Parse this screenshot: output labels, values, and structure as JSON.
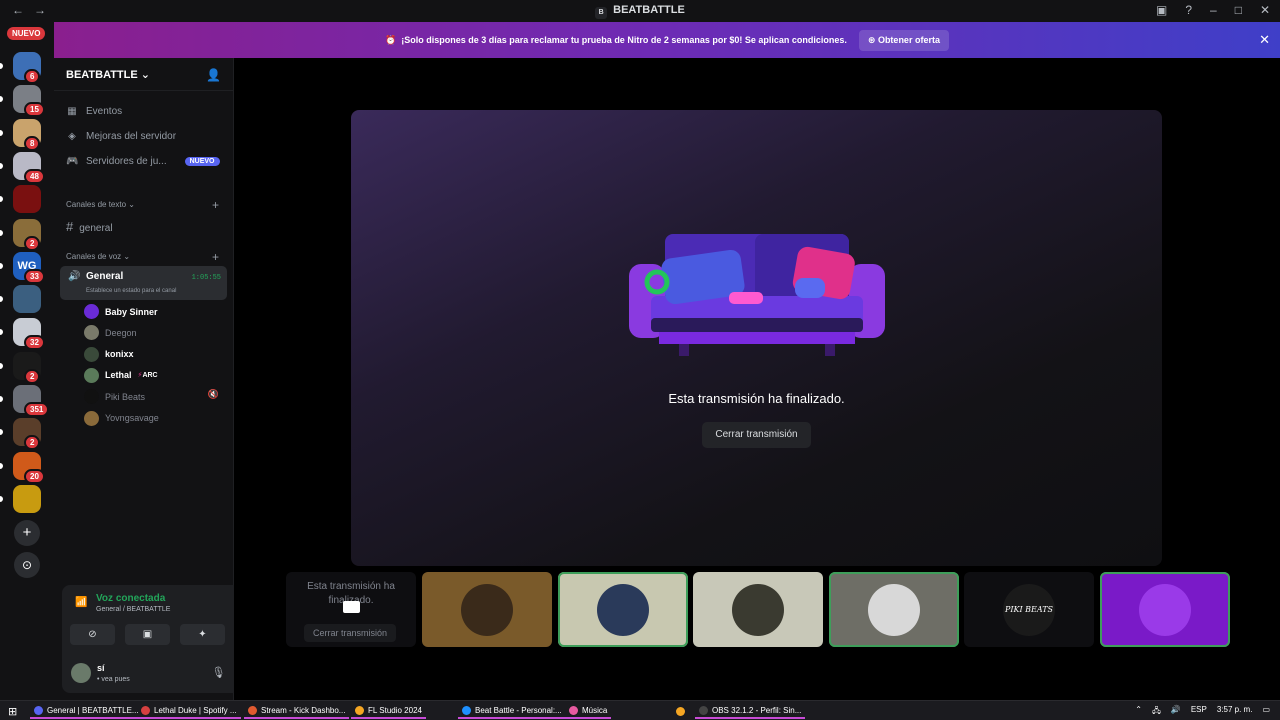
{
  "titlebar": {
    "server_badge": "B",
    "title": "BEATBATTLE"
  },
  "servers": {
    "nuevo_label": "NUEVO",
    "items": [
      {
        "badge": "6",
        "color": "#3d6fb6"
      },
      {
        "badge": "15",
        "color": "#7b7f86"
      },
      {
        "badge": "8",
        "color": "#c9a36c"
      },
      {
        "badge": "48",
        "color": "#b9b9c6"
      },
      {
        "badge": "",
        "color": "#7a1010"
      },
      {
        "badge": "2",
        "color": "#8a6d3a"
      },
      {
        "badge": "33",
        "color": "#1f5fbf",
        "text": "WG"
      },
      {
        "badge": "",
        "color": "#3b5f80"
      },
      {
        "badge": "32",
        "color": "#c8ccd4"
      },
      {
        "badge": "2",
        "color": "#1a1a1a"
      },
      {
        "badge": "351",
        "color": "#6b6f78"
      },
      {
        "badge": "2",
        "color": "#5a3e2a"
      },
      {
        "badge": "20",
        "color": "#d05a1a"
      },
      {
        "badge": "",
        "color": "#c89b10"
      }
    ]
  },
  "banner": {
    "text": "¡Solo dispones de 3 días para reclamar tu prueba de Nitro de 2 semanas por $0! Se aplican condiciones.",
    "button": "Obtener oferta"
  },
  "sidebar": {
    "server_name": "BEATBATTLE",
    "menu": [
      {
        "label": "Eventos"
      },
      {
        "label": "Mejoras del servidor"
      },
      {
        "label": "Servidores de ju...",
        "tag": "NUEVO"
      }
    ],
    "text_category": "Canales de texto",
    "text_channels": [
      {
        "name": "general"
      }
    ],
    "voice_category": "Canales de voz",
    "voice_channel": {
      "name": "General",
      "timer": "1:05:55",
      "status": "Establece un estado para el canal"
    },
    "voice_users": [
      {
        "name": "Baby Sinner",
        "color": "#6a2bd6",
        "active": true
      },
      {
        "name": "Deegon",
        "color": "#7a7a6a",
        "active": false
      },
      {
        "name": "konixx",
        "color": "#3a4a3a",
        "active": true
      },
      {
        "name": "Lethal",
        "tag": "ARC",
        "color": "#5a7a5a",
        "active": true
      },
      {
        "name": "Piki Beats",
        "color": "#111111",
        "active": false,
        "muted": true
      },
      {
        "name": "Yovngsavage",
        "color": "#8a6a3a",
        "active": false
      }
    ]
  },
  "userpanel": {
    "voice_title": "Voz conectada",
    "voice_sub": "General / BEATBATTLE",
    "username": "sí",
    "status": "• vea pues"
  },
  "stream": {
    "ended_text": "Esta transmisión ha finalizado.",
    "close_button": "Cerrar transmisión"
  },
  "tiles": {
    "first_text": "Esta transmisión ha finalizado.",
    "first_button": "Cerrar transmisión",
    "others": [
      {
        "bg": "#7a5a2a",
        "circ": "#3a2a1a",
        "ring": false
      },
      {
        "bg": "#c8c8b0",
        "circ": "#2a3a5a",
        "ring": true
      },
      {
        "bg": "#c8c8b8",
        "circ": "#3a3a30",
        "ring": false
      },
      {
        "bg": "#6e6e66",
        "circ": "#d8d8d8",
        "ring": true
      },
      {
        "bg": "#0e0e11",
        "circ": "#1a1a1a",
        "ring": false,
        "text": "PIKI BEATS"
      },
      {
        "bg": "#7a1ac8",
        "circ": "#9a3ae8",
        "ring": true
      }
    ]
  },
  "taskbar": {
    "items": [
      {
        "label": "General | BEATBATTLE...",
        "color": "#5865f2"
      },
      {
        "label": "Lethal Duke | Spotify ...",
        "color": "#d64040"
      },
      {
        "label": "Stream - Kick Dashbo...",
        "color": "#e05a30"
      },
      {
        "label": "FL Studio 2024",
        "color": "#f5a623"
      },
      {
        "label": "Beat Battle - Personal:...",
        "color": "#1e90ff"
      },
      {
        "label": "Música",
        "color": "#e85aa0"
      },
      {
        "label": "",
        "color": "#f5a623"
      },
      {
        "label": "OBS 32.1.2 - Perfil: Sin...",
        "color": "#444444"
      }
    ],
    "lang": "ESP",
    "time": "3:57 p. m."
  }
}
